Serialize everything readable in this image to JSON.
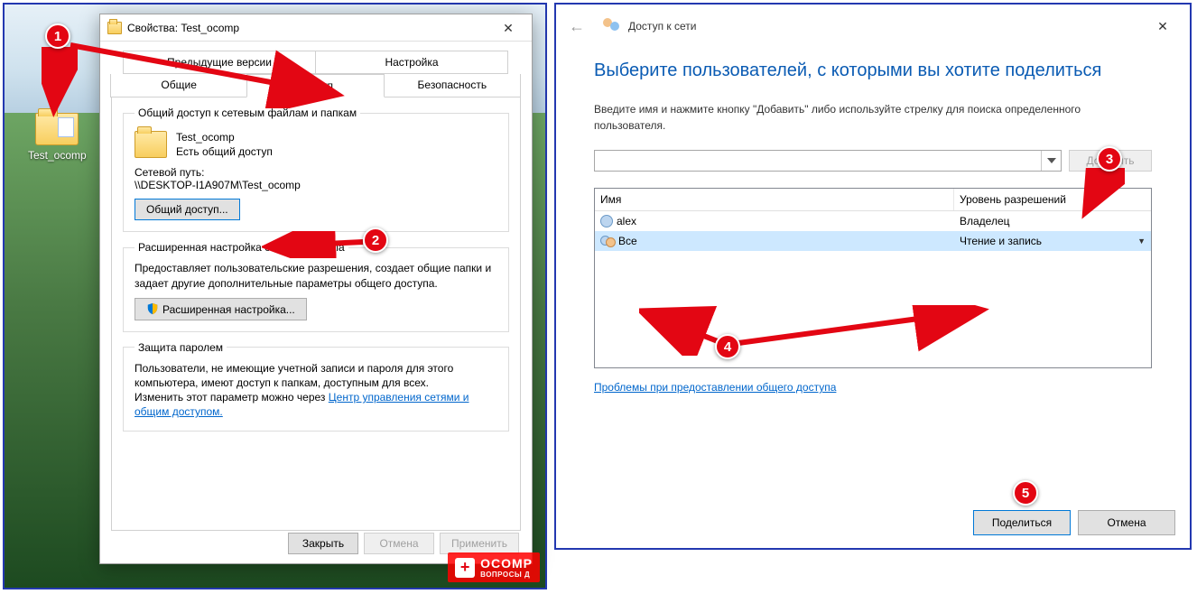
{
  "desktop": {
    "folder_label": "Test_ocomp"
  },
  "props": {
    "title": "Свойства: Test_ocomp",
    "tabs": {
      "prev_versions": "Предыдущие версии",
      "customize": "Настройка",
      "general": "Общие",
      "sharing": "Доступ",
      "security": "Безопасность"
    },
    "share_group": {
      "legend": "Общий доступ к сетевым файлам и папкам",
      "folder_name": "Test_ocomp",
      "share_state": "Есть общий доступ",
      "path_label": "Сетевой путь:",
      "path_value": "\\\\DESKTOP-I1A907M\\Test_ocomp",
      "share_btn": "Общий доступ..."
    },
    "adv_group": {
      "legend": "Расширенная настройка общего доступа",
      "desc": "Предоставляет пользовательские разрешения, создает общие папки и задает другие дополнительные параметры общего доступа.",
      "btn": "Расширенная настройка..."
    },
    "pwd_group": {
      "legend": "Защита паролем",
      "desc": "Пользователи, не имеющие учетной записи и пароля для этого компьютера, имеют доступ к папкам, доступным для всех.",
      "change_prefix": "Изменить этот параметр можно через ",
      "link": "Центр управления сетями и общим доступом."
    },
    "buttons": {
      "close": "Закрыть",
      "cancel": "Отмена",
      "apply": "Применить"
    }
  },
  "net": {
    "header": "Доступ к сети",
    "h1": "Выберите пользователей, с которыми вы хотите поделиться",
    "instr": "Введите имя и нажмите кнопку \"Добавить\" либо используйте стрелку для поиска определенного пользователя.",
    "add_btn": "Добавить",
    "cols": {
      "name": "Имя",
      "perm": "Уровень разрешений"
    },
    "rows": [
      {
        "name": "alex",
        "perm": "Владелец",
        "type": "user",
        "selected": false
      },
      {
        "name": "Все",
        "perm": "Чтение и запись",
        "type": "group",
        "selected": true
      }
    ],
    "trouble_link": "Проблемы при предоставлении общего доступа",
    "footer": {
      "share": "Поделиться",
      "cancel": "Отмена"
    }
  },
  "watermark": {
    "brand": "OCOMP",
    "sub": "ВОПРОСЫ Д"
  },
  "badges": {
    "b1": "1",
    "b2": "2",
    "b3": "3",
    "b4": "4",
    "b5": "5"
  }
}
